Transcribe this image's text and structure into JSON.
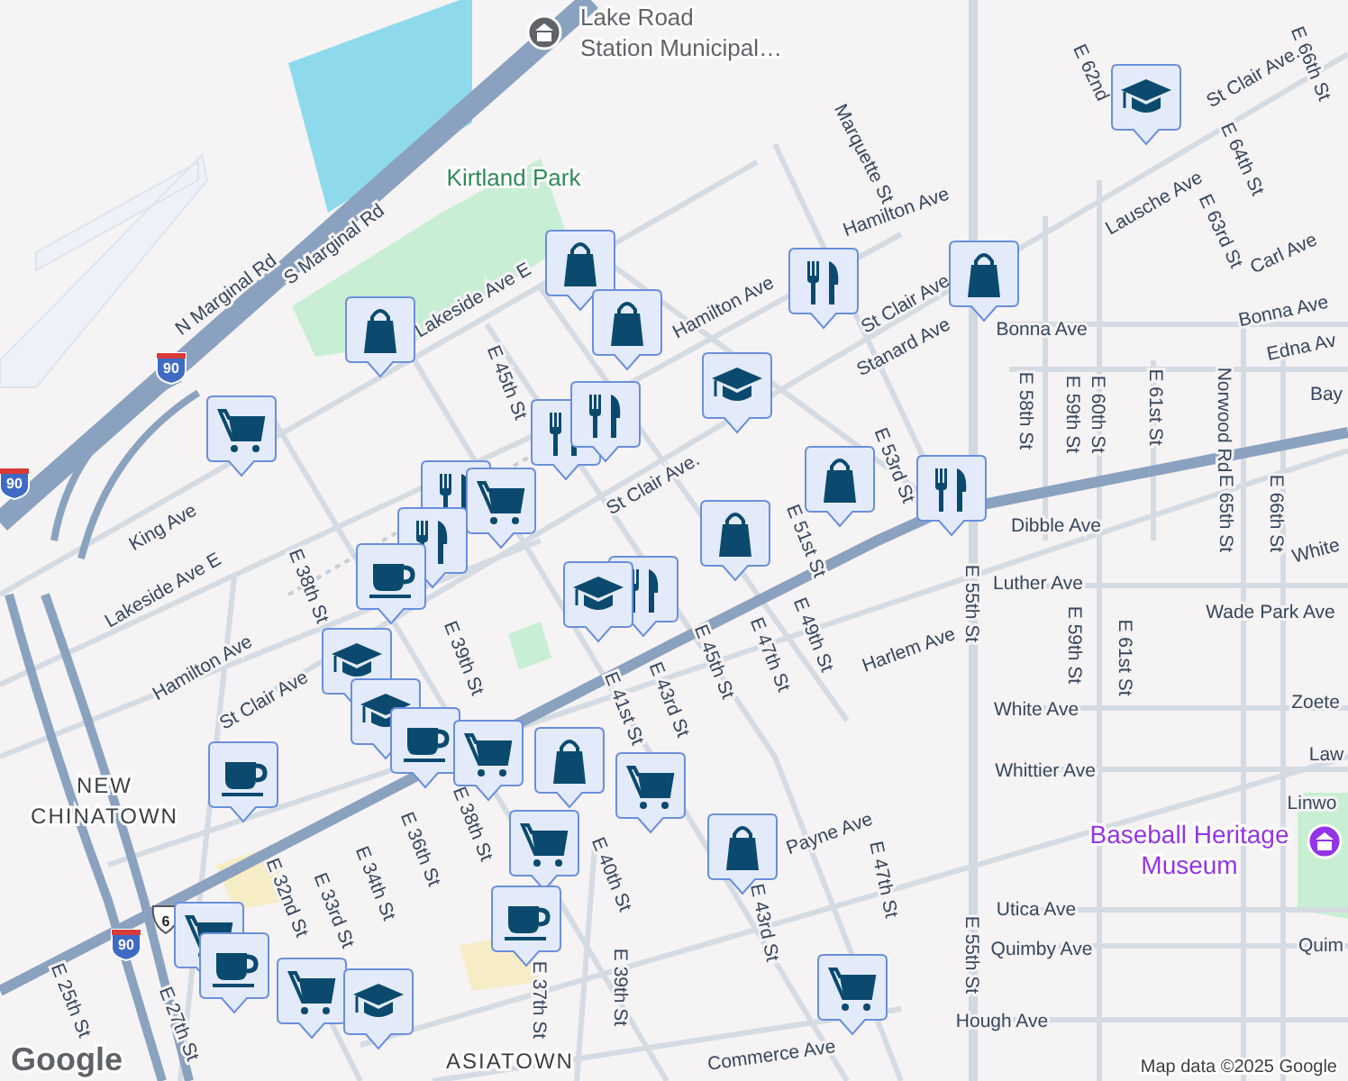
{
  "map": {
    "places": [
      {
        "kind": "landmark",
        "lines": [
          "Lake Road",
          "Station Municipal…"
        ]
      },
      {
        "kind": "park",
        "lines": [
          "Kirtland Park"
        ]
      },
      {
        "kind": "neighborhood",
        "lines": [
          "NEW",
          "CHINATOWN"
        ]
      },
      {
        "kind": "neighborhood",
        "lines": [
          "ASIATOWN"
        ]
      },
      {
        "kind": "museum",
        "lines": [
          "Baseball Heritage",
          "Museum"
        ]
      }
    ],
    "streets": [
      "E 66th St",
      "St Clair Ave.",
      "E 62nd",
      "Marquette St",
      "E 64th St",
      "Lausche Ave",
      "Hamilton Ave",
      "E 63rd St",
      "S Marginal Rd",
      "Carl Ave",
      "St Clair Ave",
      "Lakeside Ave E",
      "N Marginal Rd",
      "Hamilton Ave",
      "Bonna Ave",
      "Bonna Ave",
      "Stanard Ave",
      "Edna Av",
      "E 45th St",
      "Bay",
      "E 58th St",
      "E 59th St",
      "E 60th St",
      "E 61st St",
      "Norwood Rd",
      "E 53rd St",
      "St Clair Ave.",
      "E 65th St",
      "E 66th St",
      "Dibble Ave",
      "King Ave",
      "E 51st St",
      "White",
      "Luther Ave",
      "E 38th St",
      "Lakeside Ave E",
      "E 55th St",
      "Wade Park Ave",
      "E 49th St",
      "E 59th St",
      "Harlem Ave",
      "E 47th St",
      "E 61st St",
      "E 39th St",
      "E 45th St",
      "Hamilton Ave",
      "E 43rd St",
      "St Clair Ave",
      "Zoete",
      "White Ave",
      "E 41st St",
      "Law",
      "Whittier Ave",
      "Linwo",
      "E 38th St",
      "Payne Ave",
      "E 36th St",
      "E 40th St",
      "E 47th St",
      "E 34th St",
      "E 32nd St",
      "E 33rd St",
      "Utica Ave",
      "E 43rd St",
      "Quim",
      "Quimby Ave",
      "E 55th St",
      "E 39th St",
      "E 25th St",
      "E 37th St",
      "Hough Ave",
      "E 27th St",
      "Commerce Ave"
    ],
    "shields": [
      {
        "kind": "interstate",
        "number": "90"
      },
      {
        "kind": "interstate",
        "number": "90"
      },
      {
        "kind": "interstate",
        "number": "90"
      },
      {
        "kind": "us",
        "number": "6"
      }
    ],
    "markers": [
      {
        "kind": "shopping"
      },
      {
        "kind": "shopping"
      },
      {
        "kind": "shopping"
      },
      {
        "kind": "restaurant"
      },
      {
        "kind": "shopping"
      },
      {
        "kind": "school"
      },
      {
        "kind": "school"
      },
      {
        "kind": "grocery"
      },
      {
        "kind": "restaurant"
      },
      {
        "kind": "restaurant"
      },
      {
        "kind": "shopping"
      },
      {
        "kind": "restaurant"
      },
      {
        "kind": "restaurant"
      },
      {
        "kind": "grocery"
      },
      {
        "kind": "restaurant"
      },
      {
        "kind": "shopping"
      },
      {
        "kind": "cafe"
      },
      {
        "kind": "restaurant"
      },
      {
        "kind": "school"
      },
      {
        "kind": "school"
      },
      {
        "kind": "school"
      },
      {
        "kind": "cafe"
      },
      {
        "kind": "grocery"
      },
      {
        "kind": "shopping"
      },
      {
        "kind": "grocery"
      },
      {
        "kind": "cafe"
      },
      {
        "kind": "shopping"
      },
      {
        "kind": "grocery"
      },
      {
        "kind": "cafe"
      },
      {
        "kind": "grocery"
      },
      {
        "kind": "cafe"
      },
      {
        "kind": "grocery"
      },
      {
        "kind": "school"
      },
      {
        "kind": "grocery"
      }
    ]
  },
  "logo": "Google",
  "attribution": "Map data ©2025 Google"
}
